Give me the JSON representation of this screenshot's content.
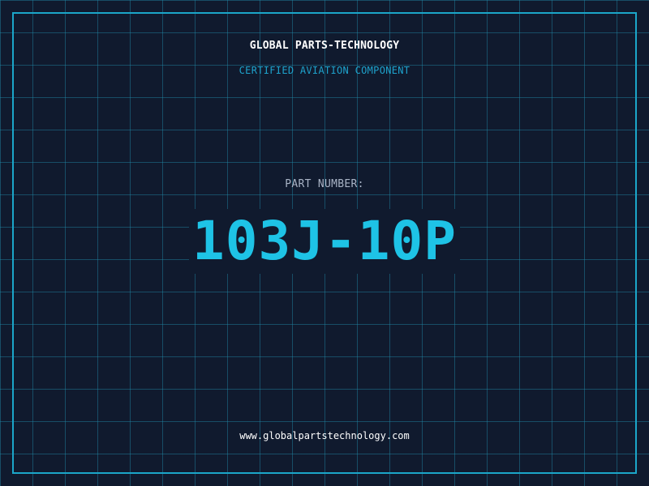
{
  "brand": {
    "name": "GLOBAL PARTS-TECHNOLOGY",
    "tagline": "CERTIFIED AVIATION COMPONENT"
  },
  "part": {
    "label": "PART NUMBER:",
    "number": "103J-10P"
  },
  "footer": {
    "website": "www.globalpartstechnology.com"
  },
  "colors": {
    "background": "#101a2e",
    "grid": "#208caa",
    "frame": "#1ba6c9",
    "accent": "#1ec3e6",
    "tagline": "#1ea3cd",
    "label": "#a9b4c6",
    "text": "#ffffff"
  }
}
